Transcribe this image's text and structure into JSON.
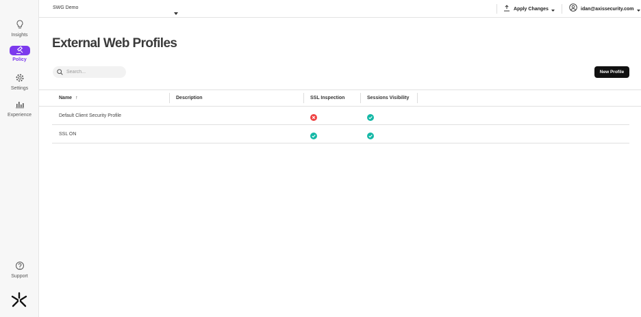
{
  "sidebar": {
    "items": [
      {
        "label": "Insights",
        "icon": "lightbulb-icon"
      },
      {
        "label": "Policy",
        "icon": "gavel-icon",
        "active": true
      },
      {
        "label": "Settings",
        "icon": "gear-icon"
      },
      {
        "label": "Experience",
        "icon": "bar-chart-icon"
      }
    ],
    "support_label": "Support",
    "support_icon": "help-circle-icon",
    "logo": "axis-logo"
  },
  "topbar": {
    "tenant": "SWG Demo",
    "apply_label": "Apply Changes",
    "user_email": "idan@axissecurity.com"
  },
  "page": {
    "title": "External Web Profiles"
  },
  "search": {
    "placeholder": "Search..."
  },
  "new_button_label": "New Profile",
  "table": {
    "columns": [
      "Name",
      "Description",
      "SSL Inspection",
      "Sessions Visibility"
    ],
    "sort_indicator": "↑",
    "rows": [
      {
        "name": "Default Client Security Profile",
        "description": "",
        "ssl_inspection": false,
        "sessions_visibility": true
      },
      {
        "name": "SSL ON",
        "description": "",
        "ssl_inspection": true,
        "sessions_visibility": true
      }
    ]
  },
  "colors": {
    "accent": "#7c3aed",
    "success": "#14b8a6",
    "error": "#ef4444",
    "button_bg": "#111111"
  }
}
